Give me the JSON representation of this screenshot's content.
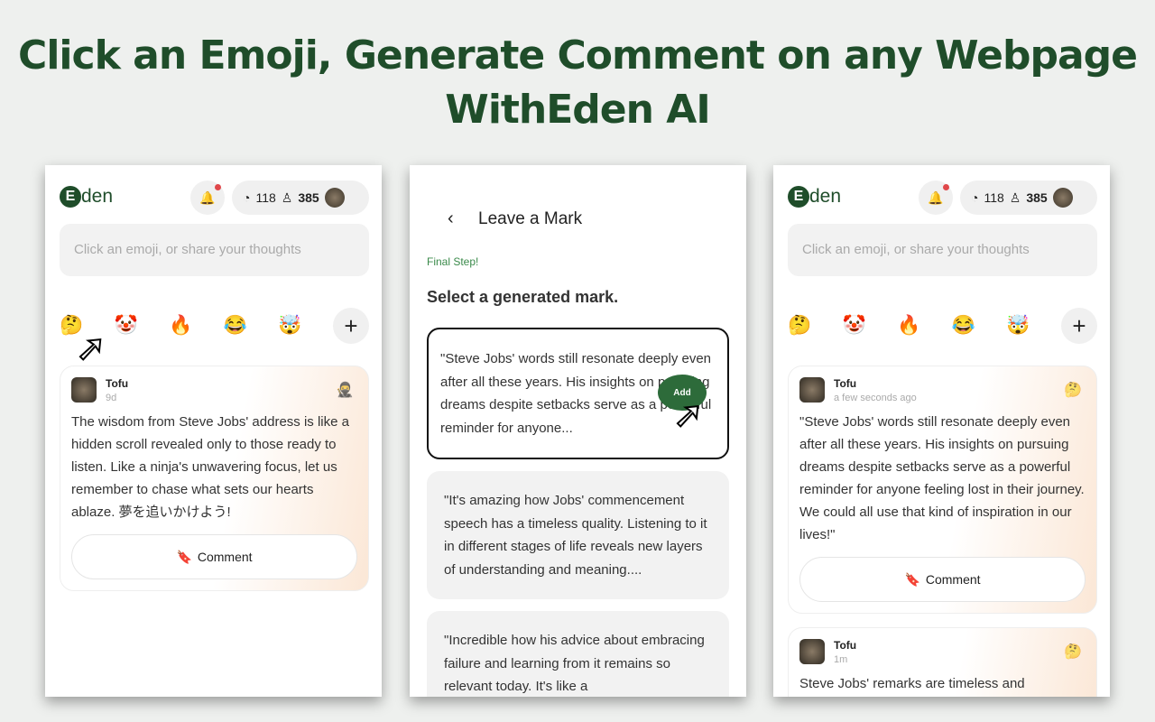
{
  "headline": {
    "line1": "Click an Emoji, Generate Comment on any Webpage",
    "line2": "WithEden AI"
  },
  "app": {
    "logo_letter": "E",
    "logo_text": "den",
    "bell_icon": "bell-icon",
    "comments_count": "118",
    "users_count": "385",
    "input_placeholder": "Click an emoji, or share your thoughts",
    "emojis": [
      "🤔",
      "🤡",
      "🔥",
      "😂",
      "🤯"
    ],
    "plus": "+"
  },
  "left": {
    "post": {
      "name": "Tofu",
      "time": "9d",
      "badge": "🥷",
      "text": "The wisdom from Steve Jobs' address is like a hidden scroll revealed only to those ready to listen. Like a ninja's unwavering focus, let us remember to chase what sets our hearts ablaze. 夢を追いかけよう!",
      "button": "Comment"
    }
  },
  "middle": {
    "back": "‹",
    "title": "Leave a Mark",
    "step": "Final Step!",
    "subtitle": "Select a generated mark.",
    "add_label": "Add",
    "options": [
      "\"Steve Jobs' words still resonate deeply even after all these years. His insights on pursuing dreams despite setbacks serve as a powerful reminder for anyone...",
      "\"It's amazing how Jobs' commencement speech has a timeless quality. Listening to it in different stages of life reveals new layers of understanding and meaning....",
      "\"Incredible how his advice about embracing failure and learning from it remains so relevant today. It's like a"
    ]
  },
  "right": {
    "posts": [
      {
        "name": "Tofu",
        "time": "a few seconds ago",
        "badge": "🤔",
        "text": "\"Steve Jobs' words still resonate deeply even after all these years. His insights on pursuing dreams despite setbacks serve as a powerful reminder for anyone feeling lost in their journey. We could all use that kind of inspiration in our lives!\"",
        "button": "Comment"
      },
      {
        "name": "Tofu",
        "time": "1m",
        "badge": "🤔",
        "text": "Steve Jobs' remarks are timeless and"
      }
    ]
  }
}
